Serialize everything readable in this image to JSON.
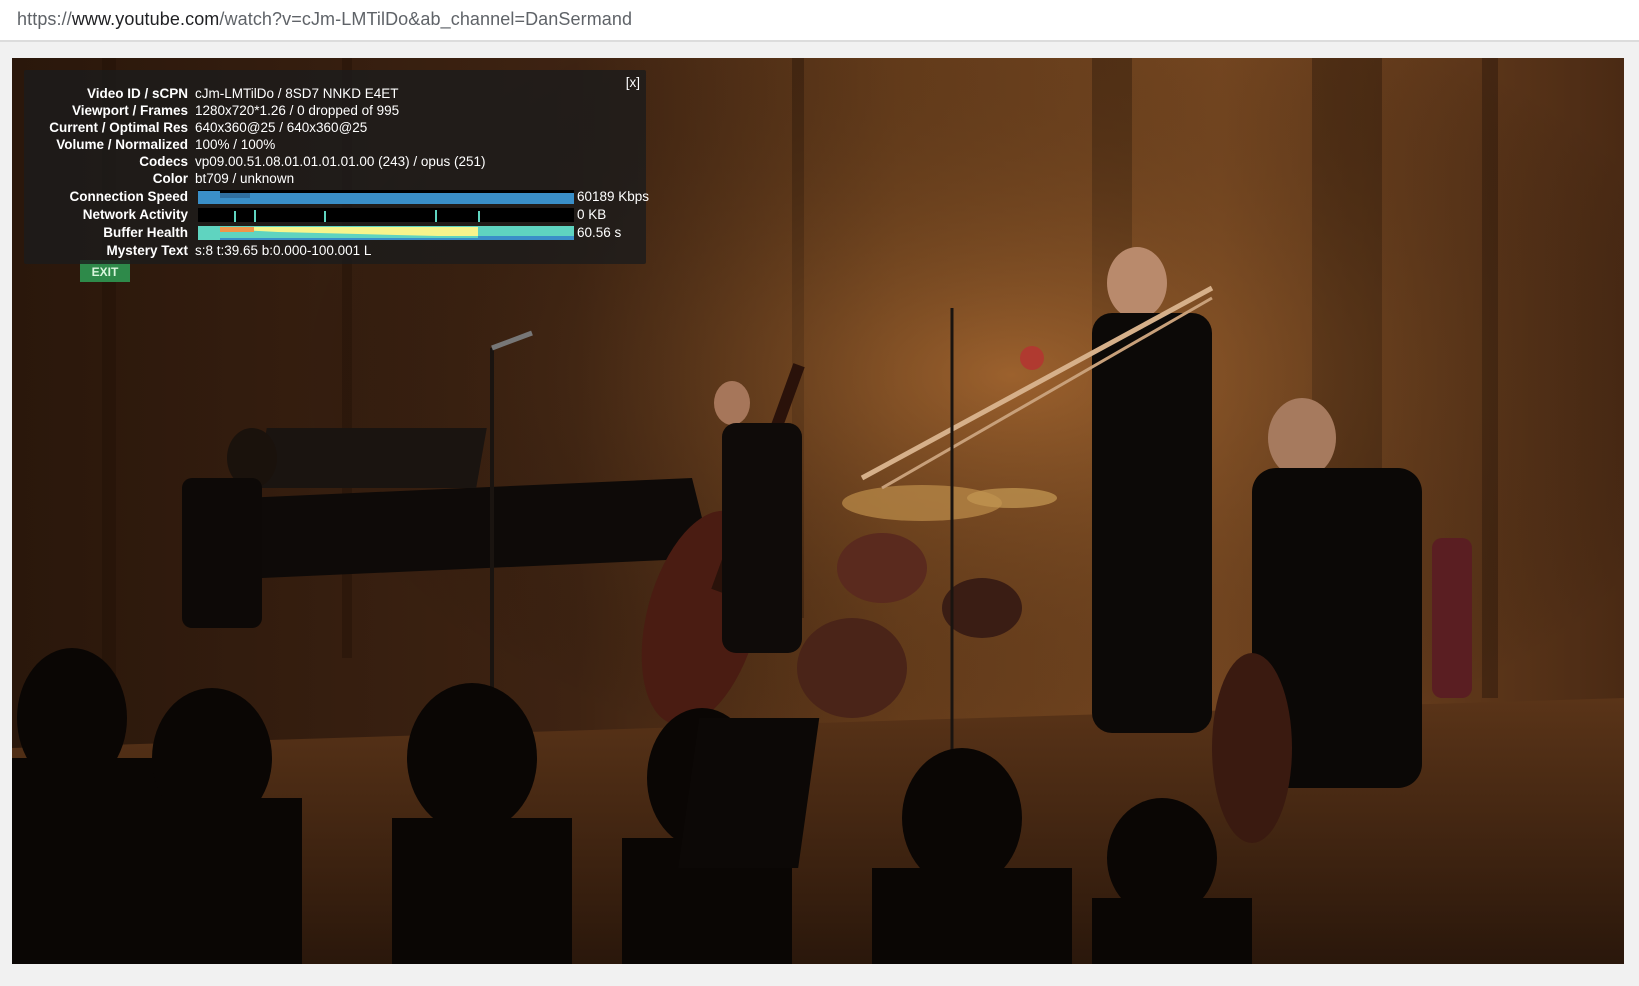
{
  "address_bar": {
    "scheme": "https://",
    "host": "www.youtube.com",
    "path": "/watch?v=cJm-LMTilDo&ab_channel=DanSermand"
  },
  "stats_overlay": {
    "close_label": "[x]",
    "rows": [
      {
        "label": "Video ID / sCPN",
        "value": "cJm-LMTilDo / 8SD7 NNKD E4ET"
      },
      {
        "label": "Viewport / Frames",
        "value": "1280x720*1.26 / 0 dropped of 995"
      },
      {
        "label": "Current / Optimal Res",
        "value": "640x360@25 / 640x360@25"
      },
      {
        "label": "Volume / Normalized",
        "value": "100% / 100%"
      },
      {
        "label": "Codecs",
        "value": "vp09.00.51.08.01.01.01.01.00 (243) / opus (251)"
      },
      {
        "label": "Color",
        "value": "bt709 / unknown"
      }
    ],
    "connection_speed": {
      "label": "Connection Speed",
      "value": "60189 Kbps",
      "bar_color": "#3a8fc8"
    },
    "network_activity": {
      "label": "Network Activity",
      "value": "0 KB",
      "tick_color": "#5fd4c0"
    },
    "buffer_health": {
      "label": "Buffer Health",
      "value": "60.56 s",
      "color_a": "#f7f58c",
      "color_b": "#5fd4c0",
      "color_c": "#f0954a"
    },
    "mystery_text": {
      "label": "Mystery Text",
      "value": "s:8 t:39.65 b:0.000-100.001 L"
    }
  },
  "video": {
    "exit_sign_text": "EXIT"
  }
}
